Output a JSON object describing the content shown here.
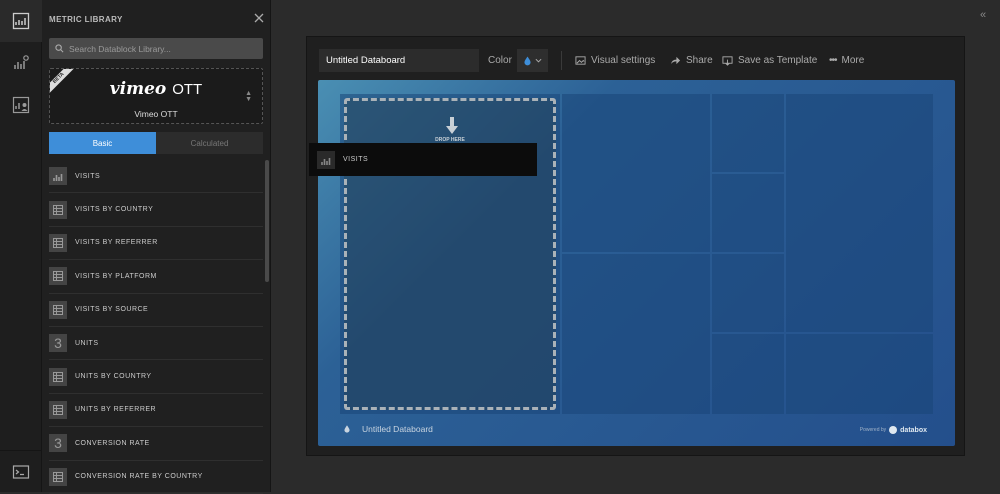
{
  "library": {
    "title": "METRIC LIBRARY",
    "search_placeholder": "Search Datablock Library...",
    "source": {
      "badge": "BETA",
      "logo": "vimeo",
      "logo_suffix": "OTT",
      "name": "Vimeo OTT"
    },
    "tabs": [
      {
        "label": "Basic",
        "active": true
      },
      {
        "label": "Calculated",
        "active": false
      }
    ],
    "metrics": [
      {
        "label": "VISITS",
        "icon": "chart-icon"
      },
      {
        "label": "VISITS BY COUNTRY",
        "icon": "table-icon"
      },
      {
        "label": "VISITS BY REFERRER",
        "icon": "table-icon"
      },
      {
        "label": "VISITS BY PLATFORM",
        "icon": "table-icon"
      },
      {
        "label": "VISITS BY SOURCE",
        "icon": "table-icon"
      },
      {
        "label": "UNITS",
        "icon": "number-icon",
        "glyph": "3"
      },
      {
        "label": "UNITS BY COUNTRY",
        "icon": "table-icon"
      },
      {
        "label": "UNITS BY REFERRER",
        "icon": "table-icon"
      },
      {
        "label": "CONVERSION RATE",
        "icon": "number-icon",
        "glyph": "3"
      },
      {
        "label": "CONVERSION RATE BY COUNTRY",
        "icon": "table-icon"
      }
    ]
  },
  "toolbar": {
    "databoard_name": "Untitled Databoard",
    "color_label": "Color",
    "visual_settings": "Visual settings",
    "share": "Share",
    "save_template": "Save as Template",
    "more": "More"
  },
  "board": {
    "drop_label": "DROP HERE",
    "footer_title": "Untitled Databoard",
    "powered_by": "Powered by",
    "brand": "databox"
  },
  "drag_ghost": {
    "label": "VISITS"
  },
  "colors": {
    "accent": "#3e8ed9",
    "board_start": "#4a8fb3",
    "board_end": "#244f8c"
  }
}
